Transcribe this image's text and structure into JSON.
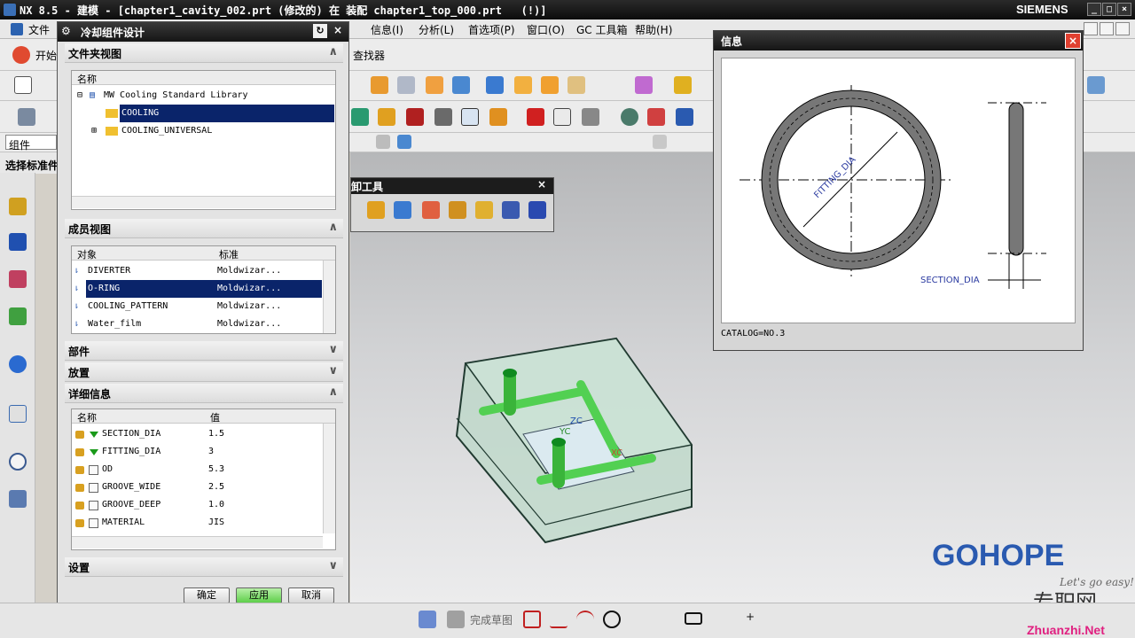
{
  "app": {
    "title": "NX 8.5 - 建模 - [chapter1_cavity_002.prt (修改的) 在 装配 chapter1_top_000.prt   (!)]",
    "brand": "SIEMENS"
  },
  "menubar": {
    "file": "文件",
    "find": "查找器",
    "info": "信息(I)",
    "analysis": "分析(L)",
    "prefs": "首选项(P)",
    "window": "窗口(O)",
    "gc": "GC 工具箱",
    "help": "帮助(H)"
  },
  "toolbar": {
    "start": "开始",
    "filter_value": "组件",
    "select_label": "选择标准件"
  },
  "dialog": {
    "title": "冷却组件设计",
    "folder_section": "文件夹视图",
    "folder_header": "名称",
    "folder_items": [
      {
        "label": "MW Cooling Standard Library"
      },
      {
        "label": "COOLING"
      },
      {
        "label": "COOLING_UNIVERSAL"
      }
    ],
    "member_section": "成员视图",
    "member_headers": [
      "对象",
      "标准"
    ],
    "members": [
      {
        "name": "DIVERTER",
        "std": "Moldwizar..."
      },
      {
        "name": "O-RING",
        "std": "Moldwizar..."
      },
      {
        "name": "COOLING_PATTERN",
        "std": "Moldwizar..."
      },
      {
        "name": "Water_film",
        "std": "Moldwizar..."
      }
    ],
    "part_section": "部件",
    "place_section": "放置",
    "detail_section": "详细信息",
    "detail_headers": [
      "名称",
      "值"
    ],
    "details": [
      {
        "name": "SECTION_DIA",
        "value": "1.5"
      },
      {
        "name": "FITTING_DIA",
        "value": "3"
      },
      {
        "name": "OD",
        "value": "5.3"
      },
      {
        "name": "GROOVE_WIDE",
        "value": "2.5"
      },
      {
        "name": "GROOVE_DEEP",
        "value": "1.0"
      },
      {
        "name": "MATERIAL",
        "value": "JIS"
      }
    ],
    "settings_section": "设置",
    "ok": "确定",
    "apply": "应用",
    "cancel": "取消"
  },
  "info_window": {
    "title": "信息",
    "fitting_label": "FITTING_DIA",
    "section_label": "SECTION_DIA",
    "catalog": "CATALOG=NO.3"
  },
  "float_toolbar": {
    "title": "卸工具"
  },
  "viewport": {
    "axis_y": "YC",
    "axis_x": "XC",
    "axis_z": "ZC"
  },
  "bottom": {
    "sketch": "完成草图"
  },
  "watermark": {
    "gohope": "GOHOPE",
    "slogan": "Let's go easy!",
    "site_cn": "专职网",
    "site": "Zhuanzhi.Net"
  }
}
